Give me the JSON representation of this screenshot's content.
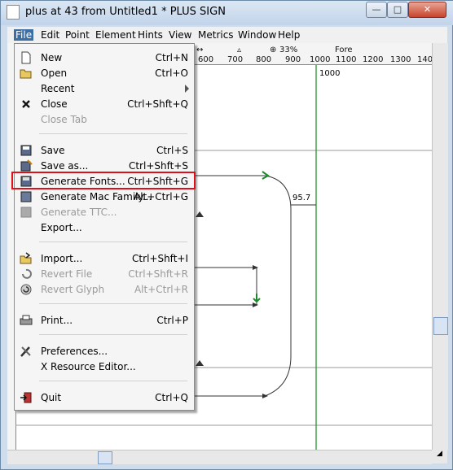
{
  "window": {
    "title": "plus at 43 from Untitled1 * PLUS SIGN",
    "minimize_label": "—",
    "maximize_label": "□",
    "close_label": "✕"
  },
  "menubar": {
    "items": [
      "File",
      "Edit",
      "Point",
      "Element",
      "Hints",
      "View",
      "Metrics",
      "Window",
      "Help"
    ]
  },
  "ruler": {
    "zoom": "33%",
    "layer": "Fore",
    "numbers": [
      "600",
      "700",
      "800",
      "900",
      "1000",
      "1100",
      "1200",
      "1300",
      "1400"
    ]
  },
  "canvas": {
    "advance_label": "1000",
    "width_label": "95.7"
  },
  "file_menu": {
    "items": [
      {
        "label": "New",
        "shortcut": "Ctrl+N",
        "icon": "new-file-icon",
        "disabled": false
      },
      {
        "label": "Open",
        "shortcut": "Ctrl+O",
        "icon": "folder-open-icon",
        "disabled": false
      },
      {
        "label": "Recent",
        "shortcut": "",
        "icon": "",
        "disabled": false,
        "submenu": true
      },
      {
        "label": "Close",
        "shortcut": "Ctrl+Shft+Q",
        "icon": "close-x-icon",
        "disabled": false
      },
      {
        "label": "Close Tab",
        "shortcut": "",
        "icon": "",
        "disabled": true
      },
      {
        "label": "Save",
        "shortcut": "Ctrl+S",
        "icon": "floppy-disk-icon",
        "disabled": false
      },
      {
        "label": "Save as...",
        "shortcut": "Ctrl+Shft+S",
        "icon": "save-as-icon",
        "disabled": false
      },
      {
        "label": "Generate Fonts...",
        "shortcut": "Ctrl+Shft+G",
        "icon": "generate-fonts-icon",
        "disabled": false,
        "highlighted": true
      },
      {
        "label": "Generate Mac Family...",
        "shortcut": "Alt+Ctrl+G",
        "icon": "generate-mac-family-icon",
        "disabled": false
      },
      {
        "label": "Generate TTC...",
        "shortcut": "",
        "icon": "generate-ttc-icon",
        "disabled": true
      },
      {
        "label": "Export...",
        "shortcut": "",
        "icon": "",
        "disabled": false
      },
      {
        "label": "Import...",
        "shortcut": "Ctrl+Shft+I",
        "icon": "import-icon",
        "disabled": false
      },
      {
        "label": "Revert File",
        "shortcut": "Ctrl+Shft+R",
        "icon": "revert-file-icon",
        "disabled": true
      },
      {
        "label": "Revert Glyph",
        "shortcut": "Alt+Ctrl+R",
        "icon": "revert-glyph-icon",
        "disabled": true
      },
      {
        "label": "Print...",
        "shortcut": "Ctrl+P",
        "icon": "printer-icon",
        "disabled": false
      },
      {
        "label": "Preferences...",
        "shortcut": "",
        "icon": "preferences-tools-icon",
        "disabled": false
      },
      {
        "label": "X Resource Editor...",
        "shortcut": "",
        "icon": "",
        "disabled": false
      },
      {
        "label": "Quit",
        "shortcut": "Ctrl+Q",
        "icon": "quit-exit-icon",
        "disabled": false
      }
    ]
  },
  "colors": {
    "guide_green": "#1a8a2a",
    "highlight_red": "#e0101a",
    "menu_active": "#3a6ea5"
  }
}
